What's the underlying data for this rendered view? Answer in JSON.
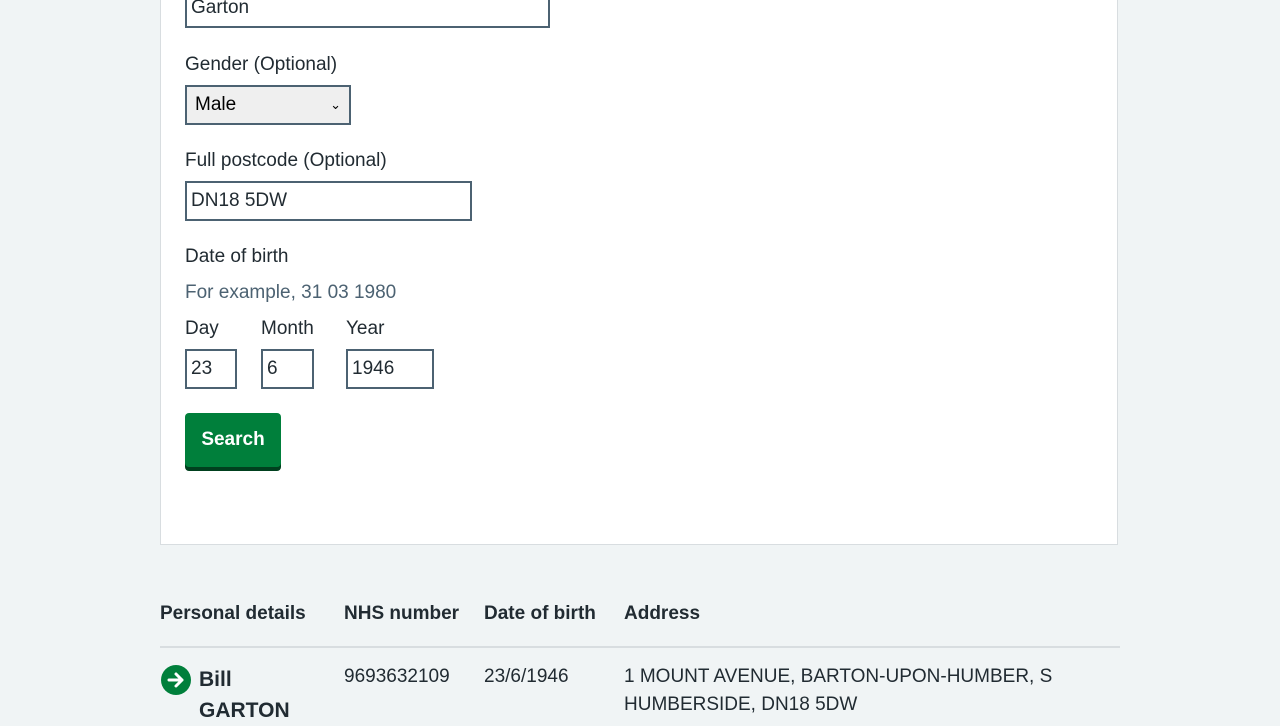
{
  "form": {
    "surname_value": "Garton",
    "gender": {
      "label": "Gender (Optional)",
      "selected": "Male"
    },
    "postcode": {
      "label": "Full postcode (Optional)",
      "value": "DN18 5DW"
    },
    "dob": {
      "label": "Date of birth",
      "hint": "For example, 31 03 1980",
      "day_label": "Day",
      "day_value": "23",
      "month_label": "Month",
      "month_value": "6",
      "year_label": "Year",
      "year_value": "1946"
    },
    "search_label": "Search"
  },
  "results": {
    "headers": [
      "Personal details",
      "NHS number",
      "Date of birth",
      "Address"
    ],
    "rows": [
      {
        "first_name": "Bill",
        "surname": "GARTON",
        "nhs_number": "9693632109",
        "dob": "23/6/1946",
        "address_line1": "1 MOUNT AVENUE, BARTON-UPON-HUMBER, S",
        "address_line2": "HUMBERSIDE, DN18 5DW",
        "icon": "arrow-right-circle-icon"
      }
    ]
  },
  "colors": {
    "primary_green": "#007f3b",
    "text": "#212b32",
    "hint": "#4c6272",
    "background": "#f0f4f5"
  }
}
